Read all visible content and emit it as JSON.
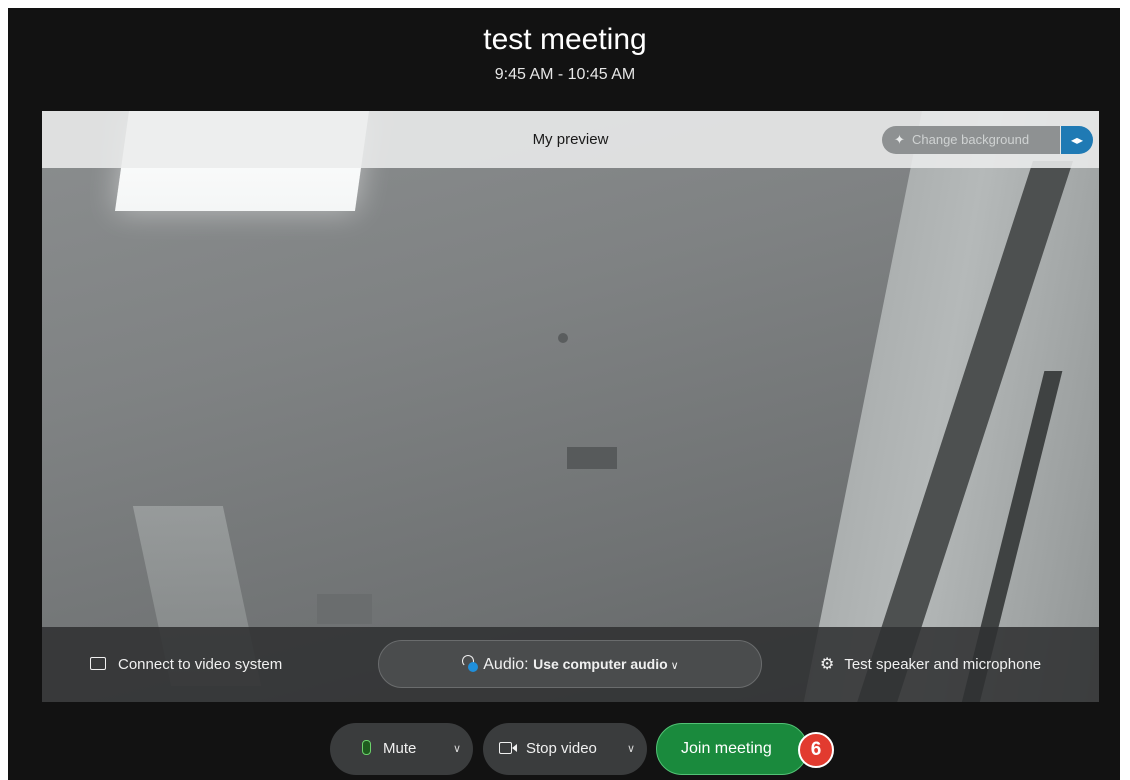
{
  "meeting": {
    "title": "test meeting",
    "time_range": "9:45 AM - 10:45 AM"
  },
  "preview": {
    "label": "My preview",
    "change_background_label": "Change background",
    "change_background_icon": "magic-wand-icon",
    "mirror_icon": "mirror-icon"
  },
  "controls": {
    "connect_label": "Connect to video system",
    "connect_icon": "cast-screen-icon",
    "audio_prefix": "Audio:",
    "audio_value": "Use computer audio",
    "audio_icon": "headset-icon",
    "test_label": "Test speaker and microphone",
    "test_icon": "gear-icon"
  },
  "bottom": {
    "mute_label": "Mute",
    "stop_video_label": "Stop video",
    "join_label": "Join meeting",
    "step_badge": "6"
  },
  "colors": {
    "join_green": "#1a8a3d",
    "badge_red": "#e23b2f",
    "mirror_blue": "#1f7ab4",
    "mic_green": "#6bd36b"
  }
}
